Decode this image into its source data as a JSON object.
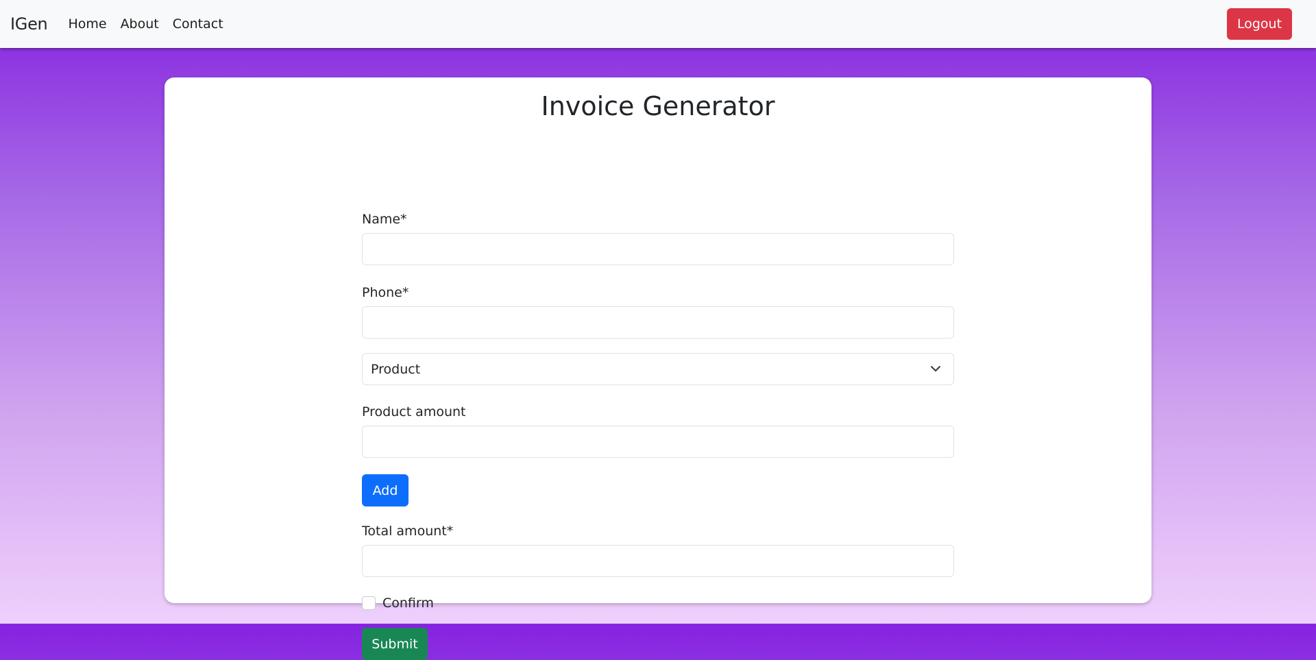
{
  "navbar": {
    "brand": "IGen",
    "links": [
      "Home",
      "About",
      "Contact"
    ],
    "logout_label": "Logout"
  },
  "form": {
    "title": "Invoice Generator",
    "name_label": "Name*",
    "name_value": "",
    "phone_label": "Phone*",
    "phone_value": "",
    "product_select_value": "Product",
    "product_amount_label": "Product amount",
    "product_amount_value": "",
    "add_label": "Add",
    "total_amount_label": "Total amount*",
    "total_amount_value": "",
    "confirm_label": "Confirm",
    "confirm_checked": false,
    "submit_label": "Submit"
  },
  "colors": {
    "navbar_bg": "#f8f9fa",
    "logout": "#dc3545",
    "add": "#0d6efd",
    "submit": "#198754",
    "background_gradient": [
      "#8522e0",
      "#efd0fc"
    ]
  },
  "icons": {
    "select_chevron": "chevron-down-icon"
  }
}
